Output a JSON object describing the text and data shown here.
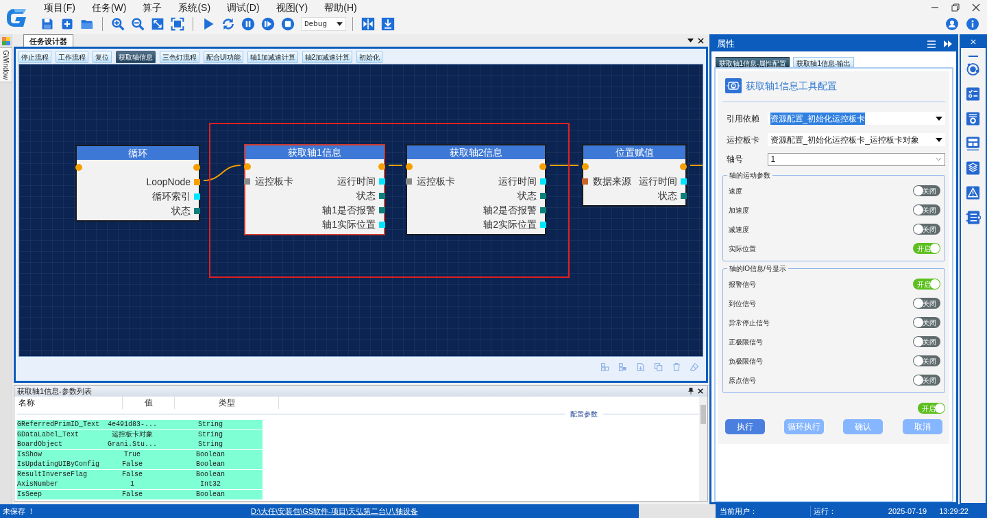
{
  "menu": [
    "项目(F)",
    "任务(W)",
    "算子",
    "系统(S)",
    "调试(D)",
    "视图(Y)",
    "帮助(H)"
  ],
  "toolbar": {
    "mode": "Debug"
  },
  "side_tab": "GWindow",
  "designer": {
    "title": "任务设计器",
    "tabs": [
      {
        "label": "停止流程",
        "selected": false
      },
      {
        "label": "工作流程",
        "selected": false
      },
      {
        "label": "复位",
        "selected": false
      },
      {
        "label": "获取轴信息",
        "selected": true
      },
      {
        "label": "三色灯流程",
        "selected": false
      },
      {
        "label": "配合UI功能",
        "selected": false
      },
      {
        "label": "轴1加减速计算",
        "selected": false
      },
      {
        "label": "轴2加减速计算",
        "selected": false
      },
      {
        "label": "初始化",
        "selected": false
      }
    ],
    "selection_frame": true,
    "nodes": [
      {
        "title": "循环",
        "selected": false,
        "rows": [
          {
            "right": {
              "label": "LoopNode",
              "color": "#f5a000"
            }
          },
          {
            "right": {
              "label": "循环索引",
              "color": "#00e5ff"
            }
          },
          {
            "right": {
              "label": "状态",
              "color": "#0e7f7a"
            }
          }
        ]
      },
      {
        "title": "获取轴1信息",
        "selected": true,
        "rows": [
          {
            "left": {
              "label": "运控板卡",
              "color": "#8a8a8a"
            },
            "right": {
              "label": "运行时间",
              "color": "#00e5ff"
            }
          },
          {
            "right": {
              "label": "状态",
              "color": "#0e7f7a"
            }
          },
          {
            "right": {
              "label": "轴1是否报警",
              "color": "#0e7f7a"
            }
          },
          {
            "right": {
              "label": "轴1实际位置",
              "color": "#00e5ff"
            }
          }
        ]
      },
      {
        "title": "获取轴2信息",
        "selected": false,
        "rows": [
          {
            "left": {
              "label": "运控板卡",
              "color": "#8a8a8a"
            },
            "right": {
              "label": "运行时间",
              "color": "#00e5ff"
            }
          },
          {
            "right": {
              "label": "状态",
              "color": "#0e7f7a"
            }
          },
          {
            "right": {
              "label": "轴2是否报警",
              "color": "#0e7f7a"
            }
          },
          {
            "right": {
              "label": "轴2实际位置",
              "color": "#00e5ff"
            }
          }
        ]
      },
      {
        "title": "位置赋值",
        "selected": false,
        "rows": [
          {
            "left": {
              "label": "数据来源",
              "color": "#c8642a"
            },
            "right": {
              "label": "运行时间",
              "color": "#00e5ff"
            }
          },
          {
            "right": {
              "label": "状态",
              "color": "#0e7f7a"
            }
          }
        ]
      }
    ]
  },
  "param_list": {
    "title": "获取轴1信息-参数列表",
    "columns": [
      "名称",
      "值",
      "类型"
    ],
    "group": "配置参数",
    "rows": [
      {
        "name": "GReferredPrimID_Text",
        "value": "4e491d83-...",
        "type": "String"
      },
      {
        "name": "GDataLabel_Text",
        "value": "运控板卡对象",
        "type": "String"
      },
      {
        "name": "BoardObject",
        "value": "Grani.Stu...",
        "type": "String"
      },
      {
        "name": "IsShow",
        "value": "True",
        "type": "Boolean"
      },
      {
        "name": "IsUpdatingUIByConfig",
        "value": "False",
        "type": "Boolean"
      },
      {
        "name": "ResultInverseFlag",
        "value": "False",
        "type": "Boolean"
      },
      {
        "name": "AxisNumber",
        "value": "1",
        "type": "Int32"
      },
      {
        "name": "IsSeep",
        "value": "False",
        "type": "Boolean"
      }
    ]
  },
  "properties": {
    "title": "属性",
    "tabs": [
      {
        "label": "获取轴1信息-属性配置",
        "selected": true
      },
      {
        "label": "获取轴1信息-输出",
        "selected": false
      }
    ],
    "heading": "获取轴1信息工具配置",
    "fields": [
      {
        "label": "引用依赖",
        "value": "资源配置_初始化运控板卡",
        "highlighted": true,
        "kind": "dropdown"
      },
      {
        "label": "运控板卡",
        "value": "资源配置_初始化运控板卡_运控板卡对象",
        "highlighted": false,
        "kind": "dropdown"
      },
      {
        "label": "轴号",
        "value": "1",
        "highlighted": false,
        "kind": "combobox"
      }
    ],
    "groups": [
      {
        "title": "轴的运动参数",
        "items": [
          {
            "label": "速度",
            "on": false,
            "state_text": "关闭"
          },
          {
            "label": "加速度",
            "on": false,
            "state_text": "关闭"
          },
          {
            "label": "减速度",
            "on": false,
            "state_text": "关闭"
          },
          {
            "label": "实际位置",
            "on": true,
            "state_text": "开启"
          }
        ]
      },
      {
        "title": "轴的IO信息/号显示",
        "items": [
          {
            "label": "报警信号",
            "on": true,
            "state_text": "开启"
          },
          {
            "label": "到位信号",
            "on": false,
            "state_text": "关闭"
          },
          {
            "label": "异常停止信号",
            "on": false,
            "state_text": "关闭"
          },
          {
            "label": "正极限信号",
            "on": false,
            "state_text": "关闭"
          },
          {
            "label": "负极限信号",
            "on": false,
            "state_text": "关闭"
          },
          {
            "label": "原点信号",
            "on": false,
            "state_text": "关闭"
          }
        ]
      }
    ],
    "extra_toggle": {
      "on": true,
      "state_text": "开启"
    },
    "buttons": [
      {
        "label": "执行",
        "disabled": false
      },
      {
        "label": "循环执行",
        "disabled": true
      },
      {
        "label": "确认",
        "disabled": true
      },
      {
        "label": "取消",
        "disabled": true
      }
    ]
  },
  "status_bar": {
    "message": "未保存 ！",
    "path": "D:\\大任\\安装包\\GS软件-项目\\天弘第二台\\八轴设备",
    "user_label": "当前用户：",
    "run_label": "运行：",
    "date": "2025-07-19",
    "time": "13:29:22"
  }
}
